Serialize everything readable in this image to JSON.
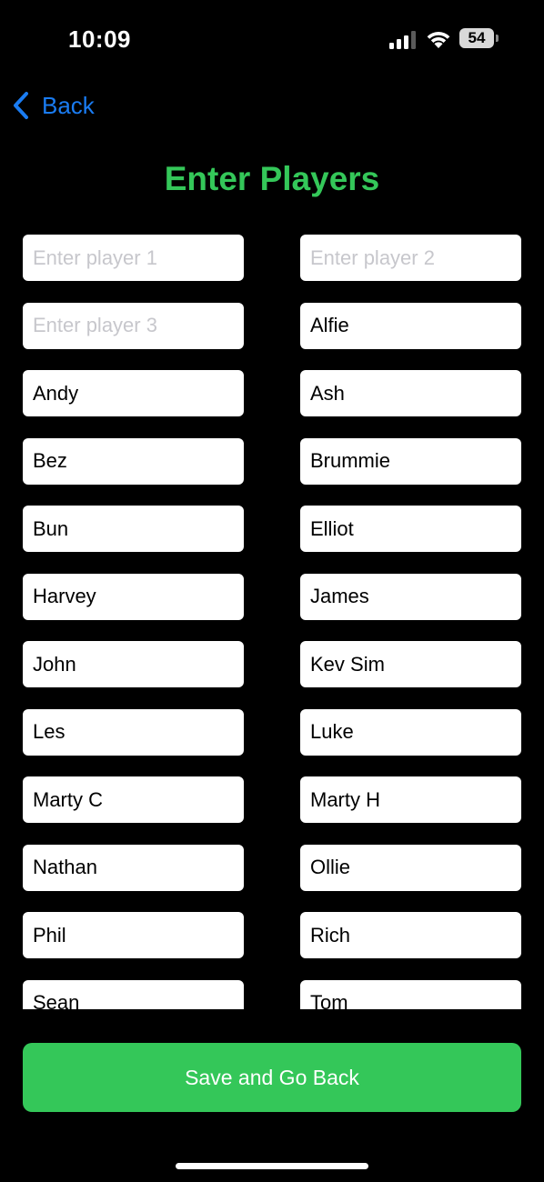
{
  "status_bar": {
    "time": "10:09",
    "battery_level": "54",
    "icons": [
      "signal-icon",
      "wifi-icon",
      "battery-icon"
    ]
  },
  "nav": {
    "back_label": "Back",
    "back_icon": "chevron-left-icon"
  },
  "title": "Enter Players",
  "players": [
    {
      "value": "",
      "placeholder": "Enter player 1"
    },
    {
      "value": "",
      "placeholder": "Enter player 2"
    },
    {
      "value": "",
      "placeholder": "Enter player 3"
    },
    {
      "value": "Alfie",
      "placeholder": ""
    },
    {
      "value": "Andy",
      "placeholder": ""
    },
    {
      "value": "Ash",
      "placeholder": ""
    },
    {
      "value": "Bez",
      "placeholder": ""
    },
    {
      "value": "Brummie",
      "placeholder": ""
    },
    {
      "value": "Bun",
      "placeholder": ""
    },
    {
      "value": "Elliot",
      "placeholder": ""
    },
    {
      "value": "Harvey",
      "placeholder": ""
    },
    {
      "value": "James",
      "placeholder": ""
    },
    {
      "value": "John",
      "placeholder": ""
    },
    {
      "value": "Kev Sim",
      "placeholder": ""
    },
    {
      "value": "Les",
      "placeholder": ""
    },
    {
      "value": "Luke",
      "placeholder": ""
    },
    {
      "value": "Marty C",
      "placeholder": ""
    },
    {
      "value": "Marty H",
      "placeholder": ""
    },
    {
      "value": "Nathan",
      "placeholder": ""
    },
    {
      "value": "Ollie",
      "placeholder": ""
    },
    {
      "value": "Phil",
      "placeholder": ""
    },
    {
      "value": "Rich",
      "placeholder": ""
    },
    {
      "value": "Sean",
      "placeholder": ""
    },
    {
      "value": "Tom",
      "placeholder": ""
    }
  ],
  "save_button_label": "Save and Go Back",
  "colors": {
    "accent_green": "#34c759",
    "link_blue": "#1a7cf2",
    "background": "#000000"
  }
}
